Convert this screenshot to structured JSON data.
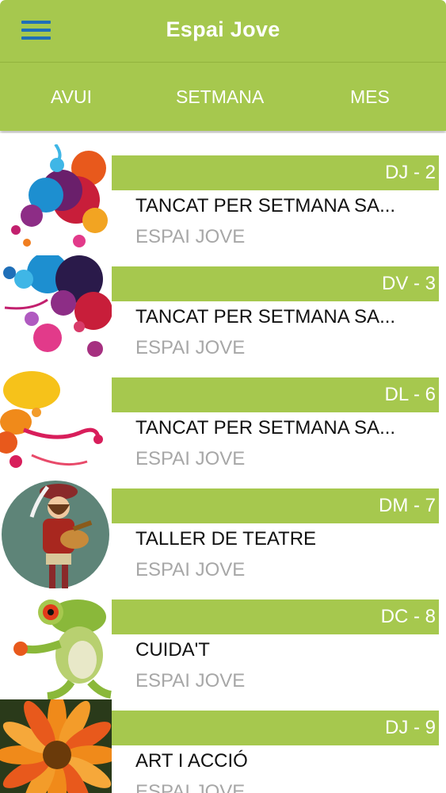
{
  "header": {
    "title": "Espai Jove",
    "menu_icon": "hamburger-menu-icon",
    "color": "#a6c84e"
  },
  "tabs": [
    {
      "label": "AVUI"
    },
    {
      "label": "SETMANA"
    },
    {
      "label": "MES"
    }
  ],
  "events": [
    {
      "date": "DJ - 2",
      "title": "TANCAT PER SETMANA SA...",
      "place": "ESPAI JOVE",
      "image": "colorful-splash-image"
    },
    {
      "date": "DV - 3",
      "title": "TANCAT PER SETMANA SA...",
      "place": "ESPAI JOVE",
      "image": "colorful-splash-image"
    },
    {
      "date": "DL - 6",
      "title": "TANCAT PER SETMANA SA...",
      "place": "ESPAI JOVE",
      "image": "colorful-splash-image"
    },
    {
      "date": "DM - 7",
      "title": "TALLER DE TEATRE",
      "place": "ESPAI JOVE",
      "image": "minstrel-image"
    },
    {
      "date": "DC - 8",
      "title": "CUIDA'T",
      "place": "ESPAI JOVE",
      "image": "frog-image"
    },
    {
      "date": "DJ - 9",
      "title": "ART I ACCIÓ",
      "place": "ESPAI JOVE",
      "image": "flower-image"
    }
  ]
}
